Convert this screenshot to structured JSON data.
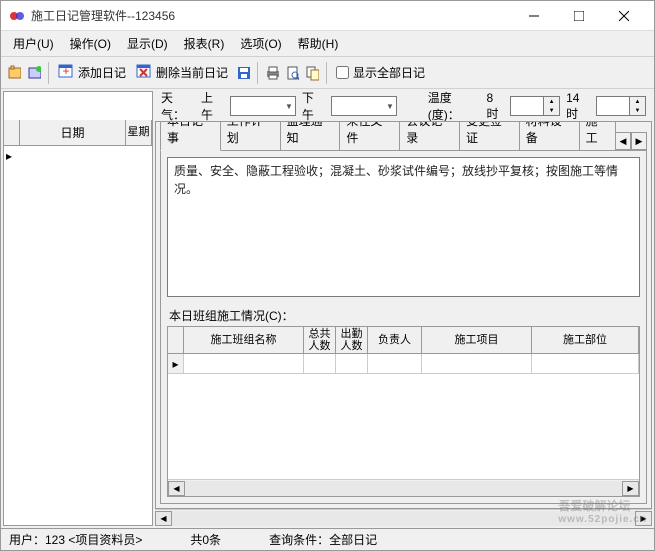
{
  "window": {
    "title": "施工日记管理软件--123456"
  },
  "menu": {
    "user": "用户(U)",
    "operate": "操作(O)",
    "display": "显示(D)",
    "report": "报表(R)",
    "option": "选项(O)",
    "help": "帮助(H)"
  },
  "toolbar": {
    "add_diary": "添加日记",
    "delete_current": "删除当前日记",
    "show_all": "显示全部日记"
  },
  "weather": {
    "label": "天气：",
    "am_label": "上午",
    "pm_label": "下午",
    "temp_label": "温度(度)：",
    "t1_label": "8时",
    "t1_value": "",
    "t2_label": "14时",
    "t2_value": ""
  },
  "leftgrid": {
    "date": "日期",
    "week": "星期"
  },
  "tabs": {
    "t0": "本日记事",
    "t1": "工作计划",
    "t2": "监理通知",
    "t3": "来往文件",
    "t4": "会议记录",
    "t5": "变更签证",
    "t6": "材料设备",
    "t7": "施工"
  },
  "memo": {
    "placeholder": "质量、安全、隐蔽工程验收；混凝土、砂浆试件编号；放线抄平复核；按图施工等情况。"
  },
  "section": {
    "team_label": "本日班组施工情况(C)："
  },
  "subgrid": {
    "c0": "施工班组名称",
    "c1": "总共人数",
    "c2": "出勤人数",
    "c3": "负责人",
    "c4": "施工项目",
    "c5": "施工部位"
  },
  "status": {
    "user": "用户：123 <项目资料员>",
    "count": "共0条",
    "cond": "查询条件：全部日记"
  },
  "watermark": {
    "main": "吾爱破解论坛",
    "sub": "www.52pojie.cn"
  }
}
